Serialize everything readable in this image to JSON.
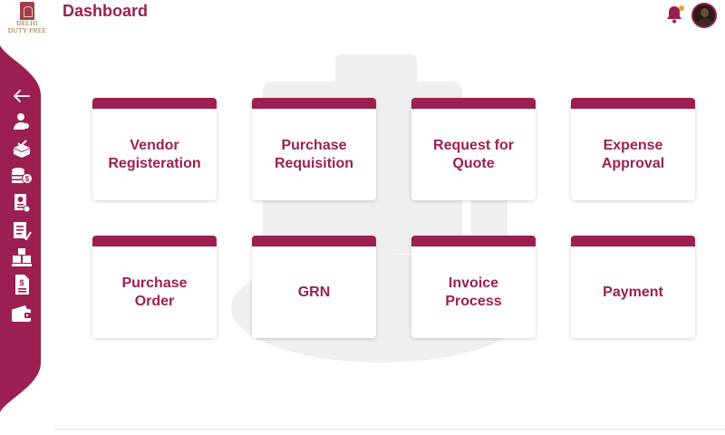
{
  "brand": {
    "logo_line1": "DELHI",
    "logo_line2": "DUTY FREE"
  },
  "header": {
    "title": "Dashboard"
  },
  "colors": {
    "primary": "#9c1f52",
    "notification_dot": "#f0a030"
  },
  "sidebar": {
    "items": [
      {
        "icon": "arrow-left-icon"
      },
      {
        "icon": "user-icon"
      },
      {
        "icon": "box-check-icon"
      },
      {
        "icon": "coins-dollar-icon"
      },
      {
        "icon": "invoice-receipt-icon"
      },
      {
        "icon": "checklist-icon"
      },
      {
        "icon": "boxes-icon"
      },
      {
        "icon": "document-dollar-icon"
      },
      {
        "icon": "wallet-icon"
      }
    ]
  },
  "cards": [
    {
      "label": "Vendor\nRegisteration"
    },
    {
      "label": "Purchase\nRequisition"
    },
    {
      "label": "Request for\nQuote"
    },
    {
      "label": "Expense\nApproval"
    },
    {
      "label": "Purchase\nOrder"
    },
    {
      "label": "GRN"
    },
    {
      "label": "Invoice\nProcess"
    },
    {
      "label": "Payment"
    }
  ]
}
